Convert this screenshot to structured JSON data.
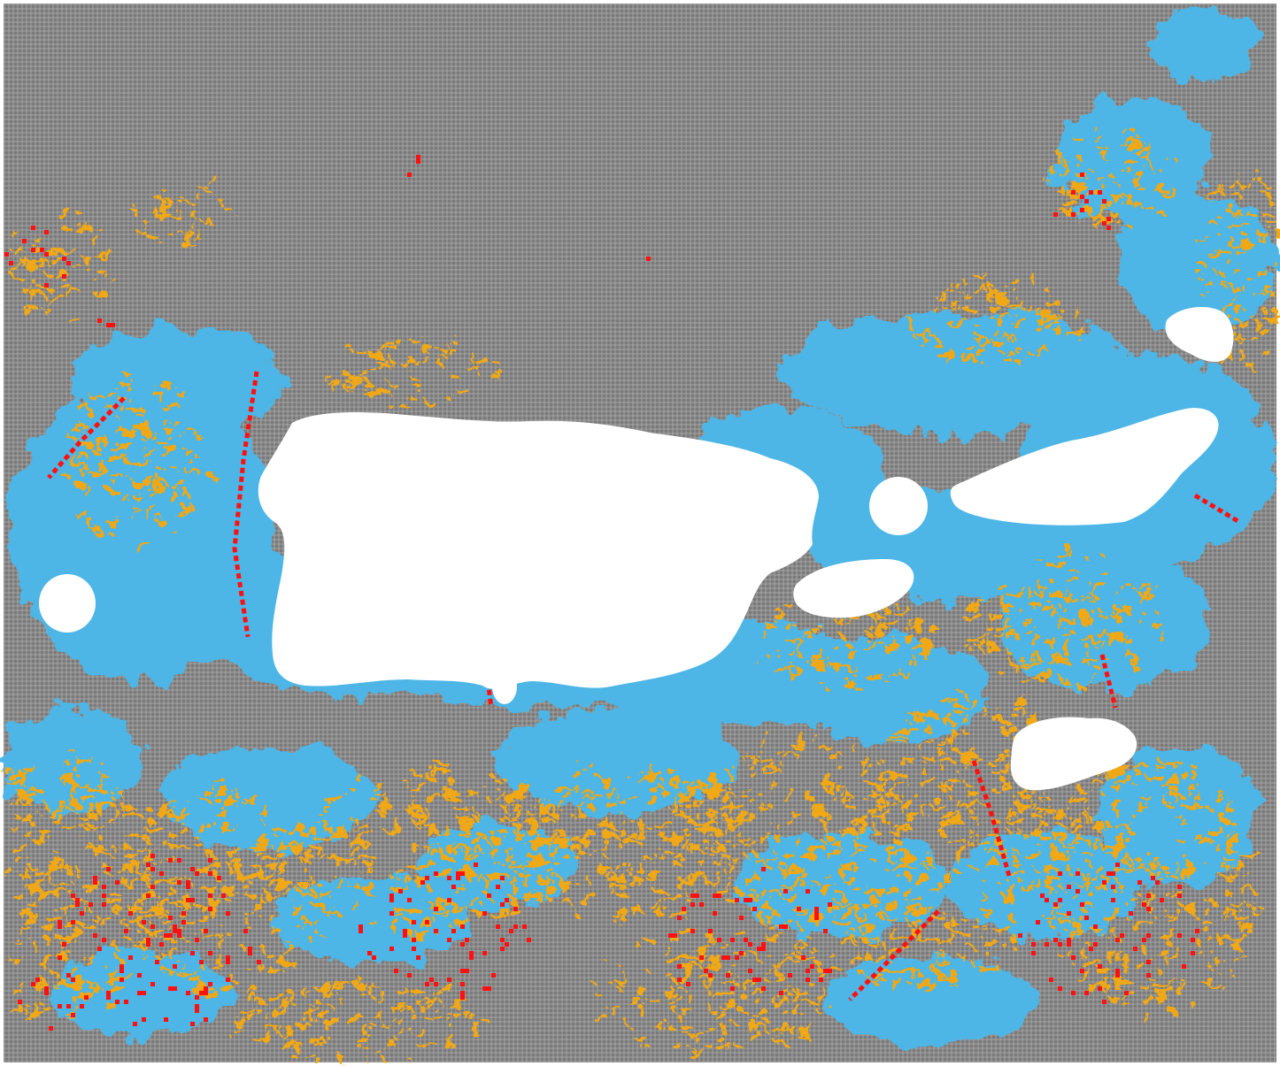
{
  "map": {
    "type": "categorical-grid-map",
    "colors": {
      "background": "#ffffff",
      "grid_dot": "#7a7a7a",
      "grid_base": "#8f8f8f",
      "land": "#ffffff",
      "class_blue": "#4db6e6",
      "class_orange": "#f0a818",
      "class_red": "#ff1010"
    },
    "classes": [
      {
        "id": "gray",
        "color": "#8a8a8a"
      },
      {
        "id": "blue",
        "color": "#4db6e6"
      },
      {
        "id": "orange",
        "color": "#f0a818"
      },
      {
        "id": "red",
        "color": "#ff1010"
      }
    ],
    "islands": [
      "main-island",
      "west-islet",
      "east-islet-large",
      "east-islet-small",
      "southeast-islet",
      "northeast-islet",
      "southeast-island",
      "south-shore-islet"
    ]
  }
}
